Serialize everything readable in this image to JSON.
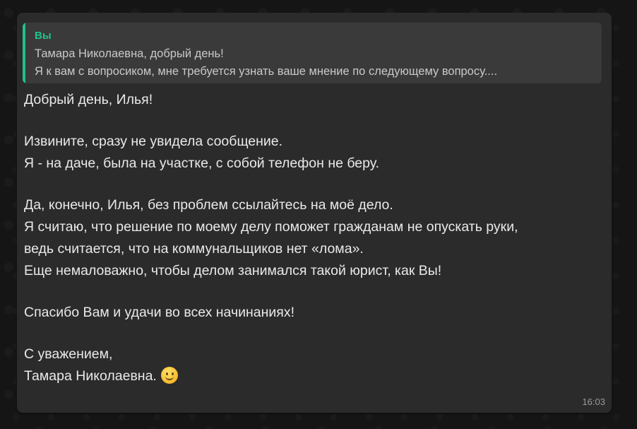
{
  "quote": {
    "author": "Вы",
    "lines": [
      "Тамара Николаевна, добрый день!",
      "Я к вам с вопросиком, мне требуется узнать ваше мнение по следующему вопросу...."
    ]
  },
  "message": {
    "lines": [
      "Добрый день, Илья!",
      "Извините, сразу не увидела сообщение.",
      "Я - на даче, была на участке, с собой телефон не беру.",
      "Да, конечно, Илья, без проблем ссылайтесь на моё дело.",
      "Я считаю, что решение по моему делу поможет гражданам не опускать руки,",
      "ведь считается, что на коммунальщиков нет «лома».",
      "Еще немаловажно, чтобы делом занимался такой юрист, как Вы!",
      "Спасибо Вам и удачи во всех начинаниях!",
      "С уважением,",
      "Тамара Николаевна."
    ],
    "emoji": "slightly-smiling-face-icon",
    "time": "16:03"
  },
  "colors": {
    "quote_accent": "#20c08c",
    "bubble_bg": "#2b2b2b",
    "quote_bg": "#3a3a3a"
  }
}
